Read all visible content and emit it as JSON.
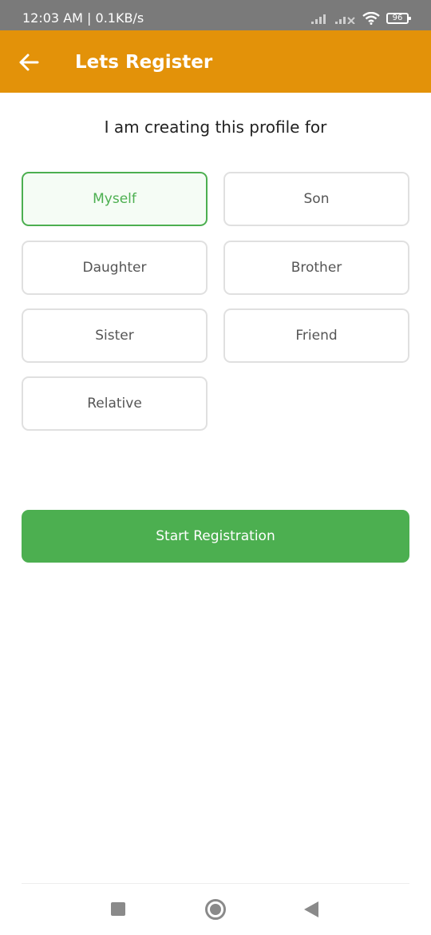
{
  "status_bar": {
    "time": "12:03 AM | 0.1KB/s",
    "battery": "96",
    "icons": [
      "signal-icon",
      "signal-no-data-icon",
      "wifi-icon",
      "battery-icon"
    ]
  },
  "header": {
    "title": "Lets Register",
    "back_icon": "arrow-left-icon",
    "background_color": "#e39209"
  },
  "prompt": "I am creating this profile for",
  "options": [
    {
      "label": "Myself",
      "selected": true
    },
    {
      "label": "Son",
      "selected": false
    },
    {
      "label": "Daughter",
      "selected": false
    },
    {
      "label": "Brother",
      "selected": false
    },
    {
      "label": "Sister",
      "selected": false
    },
    {
      "label": "Friend",
      "selected": false
    },
    {
      "label": "Relative",
      "selected": false
    }
  ],
  "start_button": {
    "label": "Start Registration",
    "color": "#4caf50"
  },
  "nav_bar": {
    "icons": [
      "recents-square-icon",
      "home-circle-icon",
      "back-triangle-icon"
    ]
  }
}
